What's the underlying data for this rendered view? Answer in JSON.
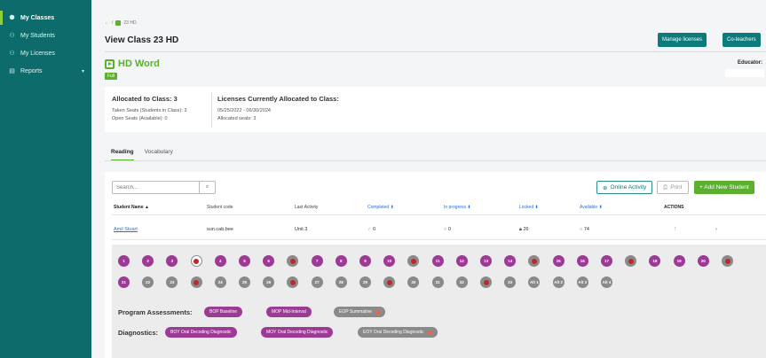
{
  "sidebar": {
    "items": [
      {
        "label": "My Classes",
        "icon": "people-icon",
        "active": true
      },
      {
        "label": "My Students",
        "icon": "person-icon",
        "active": false
      },
      {
        "label": "My Licenses",
        "icon": "key-icon",
        "active": false
      },
      {
        "label": "Reports",
        "icon": "report-icon",
        "active": false
      }
    ]
  },
  "breadcrumb": {
    "back": "←",
    "sep": "/",
    "class": "23 HD"
  },
  "page_title": "View Class 23 HD",
  "header_buttons": {
    "manage": "Manage licenses",
    "coteachers": "Co-teachers"
  },
  "product": {
    "name": "HD Word",
    "badge": "Full",
    "educator_label": "Educator:"
  },
  "allocation": {
    "allocated_title": "Allocated to Class: 3",
    "taken": "Taken Seats (Students in Class): 3",
    "open": "Open Seats (Available): 0",
    "licenses_title": "Licenses Currently Allocated to Class:",
    "date_range": "05/25/2022 - 06/30/2024",
    "allocated_seats": "Allocated seats: 3"
  },
  "tabs": [
    "Reading",
    "Vocabulary"
  ],
  "toolbar": {
    "search_placeholder": "Search...",
    "online_activity": "Online Activity",
    "print": "Print",
    "add_student": "+ Add New Student"
  },
  "table": {
    "headers": [
      "Student Name ▲",
      "Student code",
      "Last Activity",
      "Completed ⬍",
      "In progress ⬍",
      "Locked ⬍",
      "Available ⬍",
      "ACTIONS"
    ],
    "rows": [
      {
        "name": "Amil Stuart",
        "code": "sun.cab.bee",
        "last_activity": "Unit 3",
        "completed": "0",
        "in_progress": "0",
        "locked": "26",
        "available": "74",
        "actions": "⋮",
        "chevron": "›"
      }
    ]
  },
  "units_row1": [
    "1",
    "2",
    "3",
    "",
    "4",
    "5",
    "6",
    "",
    "7",
    "8",
    "9",
    "10",
    "",
    "11",
    "12",
    "13",
    "14",
    "",
    "15",
    "16",
    "17",
    "",
    "18",
    "19",
    "20",
    ""
  ],
  "units_row2": [
    "21",
    "22",
    "23",
    "",
    "24",
    "25",
    "26",
    "",
    "27",
    "28",
    "29",
    "",
    "30",
    "31",
    "32",
    "",
    "33",
    "Alt 1",
    "Alt 2",
    "Alt 3",
    "Alt 4"
  ],
  "program_assessments": {
    "label": "Program Assessments:",
    "pills": [
      "BOP Baseline",
      "MOP Mid-Interval",
      "EOP Summative"
    ]
  },
  "diagnostics": {
    "label": "Diagnostics:",
    "pills": [
      "BOY Oral Decoding Diagnostic",
      "MOY Oral Decoding Diagnostic",
      "EOY Oral Decoding Diagnostic"
    ]
  },
  "colors": {
    "sidebar": "#0e6b6b",
    "accent_green": "#5bb02d",
    "unit_purple": "#9c3a96",
    "unit_gray": "#8a8a8a",
    "lock_red": "#c0272d",
    "link_blue": "#2a6fd6"
  }
}
